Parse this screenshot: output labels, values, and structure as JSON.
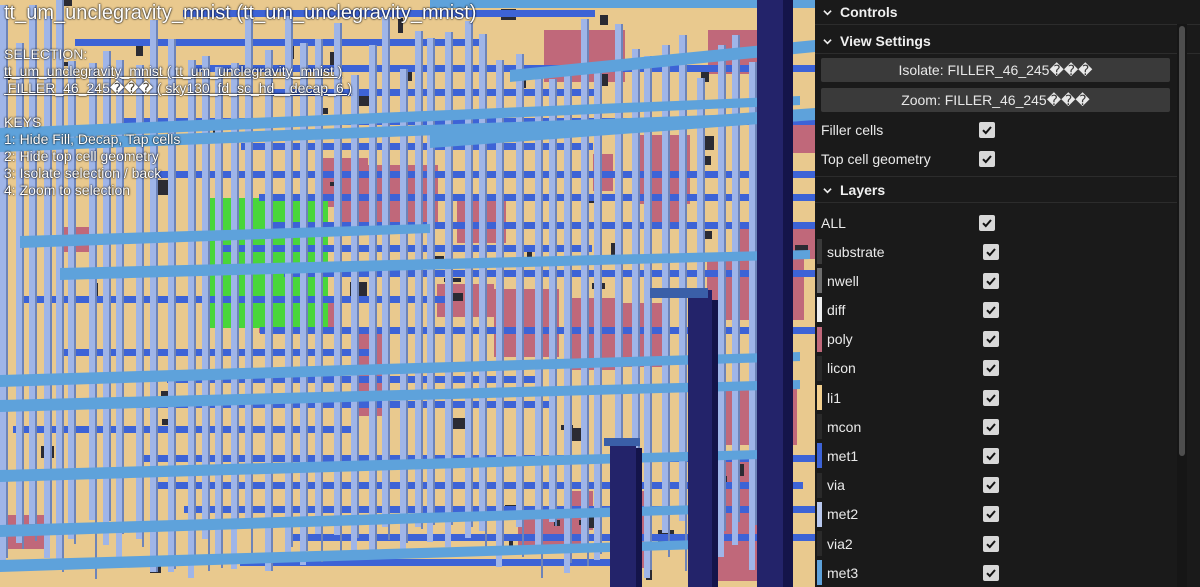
{
  "viewport": {
    "title": "tt_um_unclegravity_mnist (tt_um_unclegravity_mnist)",
    "selection_header": "SELECTION:",
    "selection_lines": [
      "tt_um_unclegravity_mnist ( tt_um_unclegravity_mnist )",
      " FILLER_46_245��� ( sky130_fd_sc_hd__decap_6 )"
    ],
    "keys_header": "KEYS",
    "keys": [
      "1: Hide Fill, Decap, Tap cells",
      "2: Hide top cell geometry",
      "3: Isolate selection / back",
      "4: Zoom to selection"
    ],
    "colors": {
      "background": "#e9c98e",
      "poly": "#c0687a",
      "met1": "#3d63d6",
      "met2": "#9fb5e8",
      "met3": "#5ea2db",
      "met4": "#23236a",
      "selected": "#49d63a"
    }
  },
  "panel": {
    "controls_label": "Controls",
    "view_settings_label": "View Settings",
    "isolate_button": "Isolate: FILLER_46_245���",
    "zoom_button": "Zoom: FILLER_46_245���",
    "toggles": [
      {
        "label": "Filler cells",
        "checked": true
      },
      {
        "label": "Top cell geometry",
        "checked": true
      }
    ],
    "layers_label": "Layers",
    "all_label": "ALL",
    "layers": [
      {
        "name": "substrate",
        "color": "#3a3a3a",
        "checked": true
      },
      {
        "name": "nwell",
        "color": "#6e6e6e",
        "checked": true
      },
      {
        "name": "diff",
        "color": "#eeeeee",
        "checked": true
      },
      {
        "name": "poly",
        "color": "#c0687a",
        "checked": true
      },
      {
        "name": "licon",
        "color": "#2a2a2a",
        "checked": true
      },
      {
        "name": "li1",
        "color": "#f2cf8e",
        "checked": true
      },
      {
        "name": "mcon",
        "color": "#2a2a2a",
        "checked": true
      },
      {
        "name": "met1",
        "color": "#3d63d6",
        "checked": true
      },
      {
        "name": "via",
        "color": "#2a2a2a",
        "checked": true
      },
      {
        "name": "met2",
        "color": "#b8c8ee",
        "checked": true
      },
      {
        "name": "via2",
        "color": "#2a2a2a",
        "checked": true
      },
      {
        "name": "met3",
        "color": "#5ea2db",
        "checked": true
      }
    ]
  }
}
